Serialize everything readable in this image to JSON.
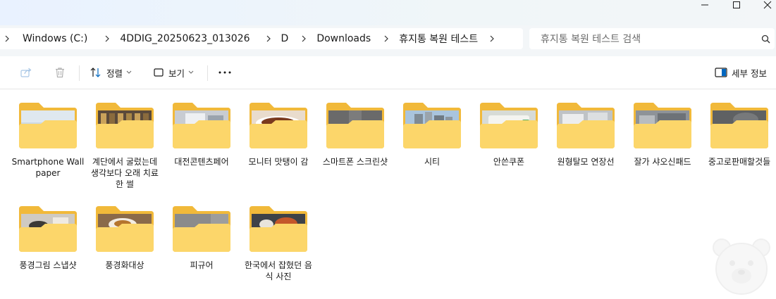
{
  "breadcrumb": {
    "items": [
      "Windows (C:)",
      "4DDIG_20250623_013026",
      "D",
      "Downloads",
      "휴지통 복원 테스트"
    ]
  },
  "search": {
    "placeholder": "휴지통 복원 테스트 검색"
  },
  "toolbar": {
    "sort_label": "정렬",
    "view_label": "보기",
    "details_label": "세부 정보"
  },
  "folders": [
    {
      "label": "Smartphone Wallpaper"
    },
    {
      "label": "계단에서 굴렀는데 생각보다 오래 치료한 썰"
    },
    {
      "label": "대전콘텐츠페어"
    },
    {
      "label": "모니터 맛탱이 감"
    },
    {
      "label": "스마트폰 스크린샷"
    },
    {
      "label": "시티"
    },
    {
      "label": "안쓴쿠폰"
    },
    {
      "label": "원형탈모 연장선"
    },
    {
      "label": "잘가 샤오신패드"
    },
    {
      "label": "중고로판매할것들"
    },
    {
      "label": "풍경그림 스냅샷"
    },
    {
      "label": "풍경화대상"
    },
    {
      "label": "피규어"
    },
    {
      "label": "한국에서 잡혔던 음식 사진"
    }
  ],
  "colors": {
    "folder_back": "#f1b93a",
    "folder_front": "#fcd66a",
    "accent": "#0067c0"
  },
  "icons": {
    "share": "share-icon",
    "delete": "trash-icon",
    "sort": "sort-icon",
    "view": "view-icon",
    "more": "more-icon",
    "details": "details-pane-icon",
    "search": "search-icon"
  }
}
